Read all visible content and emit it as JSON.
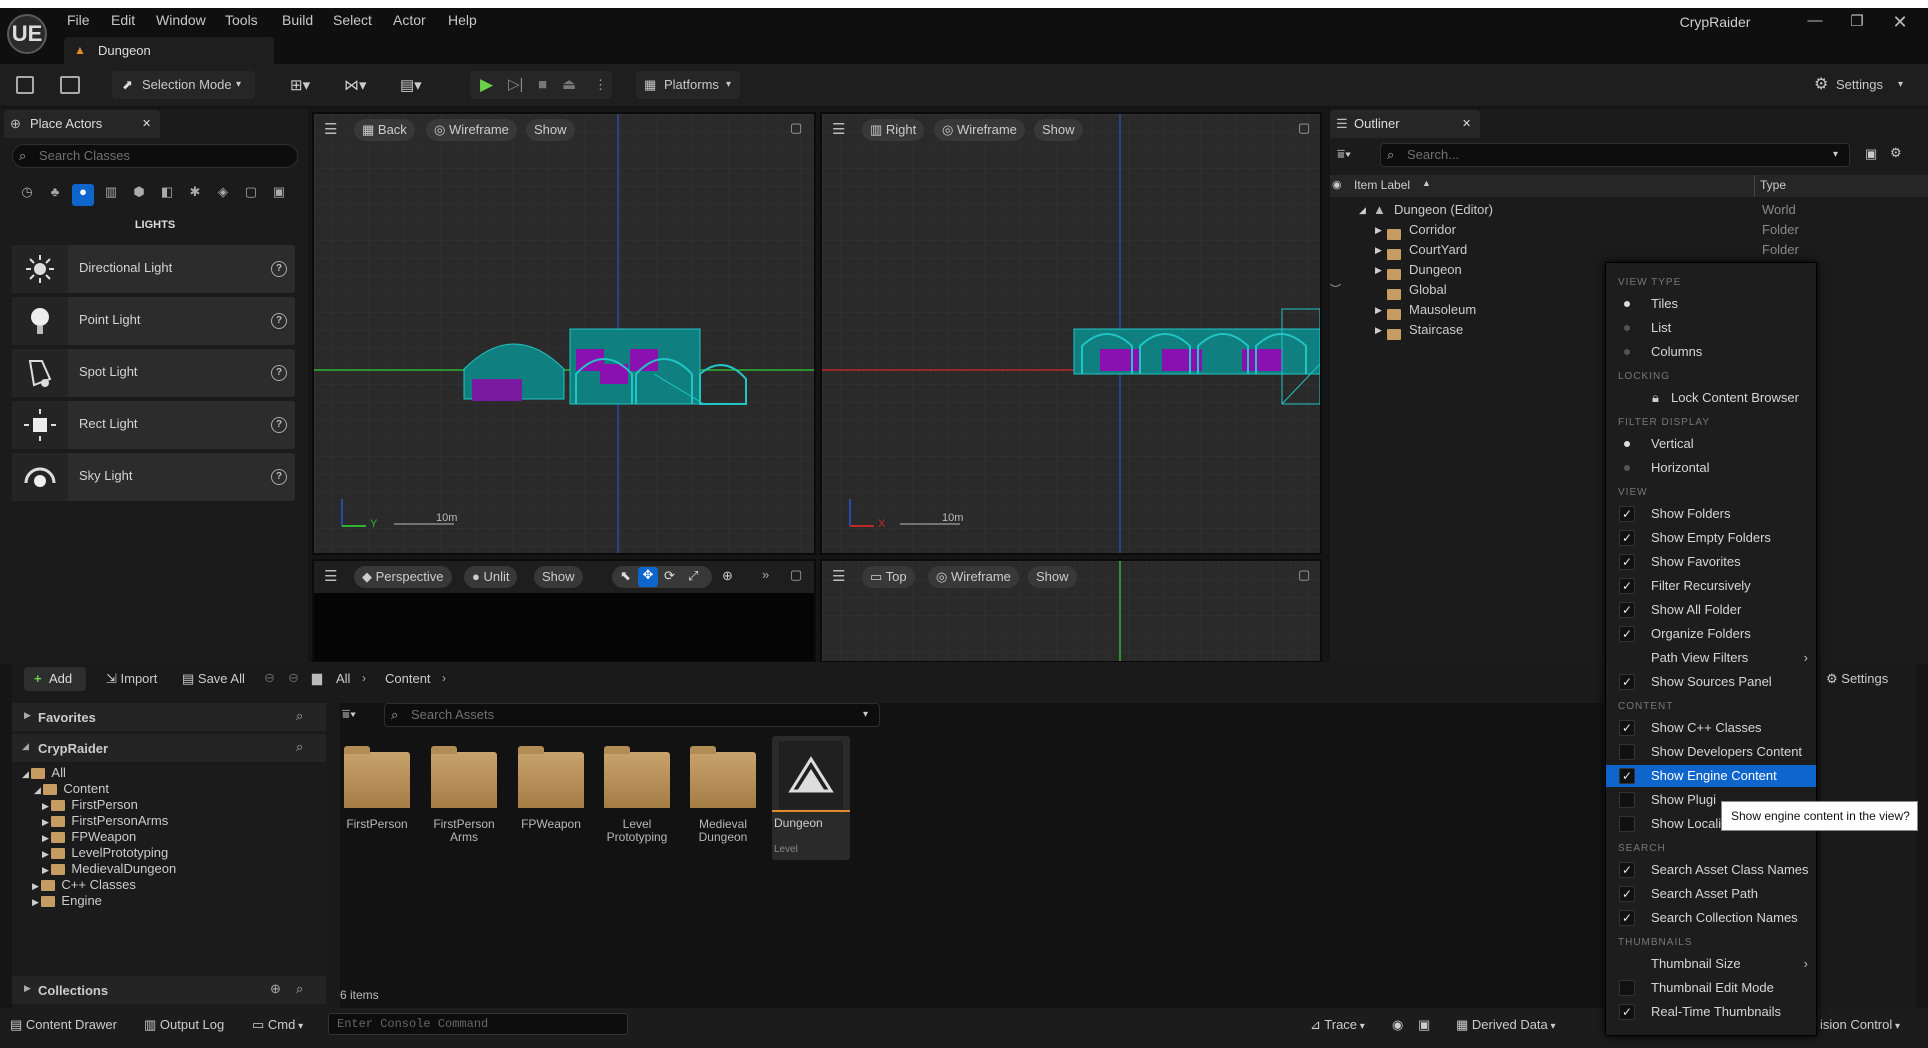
{
  "app": {
    "project_name": "CrypRaider",
    "logo": "UE"
  },
  "menu": [
    "File",
    "Edit",
    "Window",
    "Tools",
    "Build",
    "Select",
    "Actor",
    "Help"
  ],
  "level_tab": "Dungeon",
  "toolbar": {
    "mode": "Selection Mode",
    "platforms": "Platforms",
    "settings": "Settings"
  },
  "place_actors": {
    "tab": "Place Actors",
    "search_placeholder": "Search Classes",
    "category": "LIGHTS",
    "items": [
      "Directional Light",
      "Point Light",
      "Spot Light",
      "Rect Light",
      "Sky Light"
    ]
  },
  "viewports": {
    "back": {
      "view": "Back",
      "mode": "Wireframe",
      "show": "Show",
      "scale": "10m",
      "axis": "Y"
    },
    "right": {
      "view": "Right",
      "mode": "Wireframe",
      "show": "Show",
      "scale": "10m",
      "axis": "X"
    },
    "persp": {
      "view": "Perspective",
      "mode": "Unlit",
      "show": "Show"
    },
    "top": {
      "view": "Top",
      "mode": "Wireframe",
      "show": "Show"
    }
  },
  "outliner": {
    "tab": "Outliner",
    "search_placeholder": "Search...",
    "col_label": "Item Label",
    "col_type": "Type",
    "rows": [
      {
        "label": "Dungeon (Editor)",
        "type": "World"
      },
      {
        "label": "Corridor",
        "type": "Folder"
      },
      {
        "label": "CourtYard",
        "type": "Folder"
      },
      {
        "label": "Dungeon",
        "type": ""
      },
      {
        "label": "Global",
        "type": ""
      },
      {
        "label": "Mausoleum",
        "type": ""
      },
      {
        "label": "Staircase",
        "type": ""
      }
    ]
  },
  "content_browser": {
    "add": "Add",
    "import": "Import",
    "save_all": "Save All",
    "breadcrumb": [
      "All",
      "Content"
    ],
    "settings": "Settings",
    "favorites": "Favorites",
    "project": "CrypRaider",
    "tree": [
      "All",
      "Content",
      "FirstPerson",
      "FirstPersonArms",
      "FPWeapon",
      "LevelPrototyping",
      "MedievalDungeon",
      "C++ Classes",
      "Engine"
    ],
    "collections": "Collections",
    "search_placeholder": "Search Assets",
    "assets": [
      {
        "name": "FirstPerson"
      },
      {
        "name": "FirstPerson Arms"
      },
      {
        "name": "FPWeapon"
      },
      {
        "name": "Level Prototyping"
      },
      {
        "name": "Medieval Dungeon"
      },
      {
        "name": "Dungeon",
        "kind": "Level"
      }
    ],
    "count": "6 items"
  },
  "statusbar": {
    "content_drawer": "Content Drawer",
    "output_log": "Output Log",
    "cmd": "Cmd",
    "console_placeholder": "Enter Console Command",
    "trace": "Trace",
    "derived_data": "Derived Data",
    "source_control": "ision Control"
  },
  "dropdown": {
    "sections": {
      "view_type": "VIEW TYPE",
      "locking": "LOCKING",
      "filter_display": "FILTER DISPLAY",
      "view": "VIEW",
      "content": "CONTENT",
      "search": "SEARCH",
      "thumbnails": "THUMBNAILS"
    },
    "items": {
      "tiles": "Tiles",
      "list": "List",
      "columns": "Columns",
      "lock": "Lock Content Browser",
      "vertical": "Vertical",
      "horizontal": "Horizontal",
      "show_folders": "Show Folders",
      "show_empty": "Show Empty Folders",
      "show_fav": "Show Favorites",
      "filter_rec": "Filter Recursively",
      "show_all_folder": "Show All Folder",
      "organize": "Organize Folders",
      "path_filters": "Path View Filters",
      "show_sources": "Show Sources Panel",
      "show_cpp": "Show C++ Classes",
      "show_dev": "Show Developers Content",
      "show_engine": "Show Engine Content",
      "show_plugin": "Show Plugi",
      "show_local": "Show Locali",
      "search_class": "Search Asset Class Names",
      "search_path": "Search Asset Path",
      "search_coll": "Search Collection Names",
      "thumb_size": "Thumbnail Size",
      "thumb_edit": "Thumbnail Edit Mode",
      "realtime": "Real-Time Thumbnails"
    }
  },
  "tooltip": "Show engine content in the view?"
}
